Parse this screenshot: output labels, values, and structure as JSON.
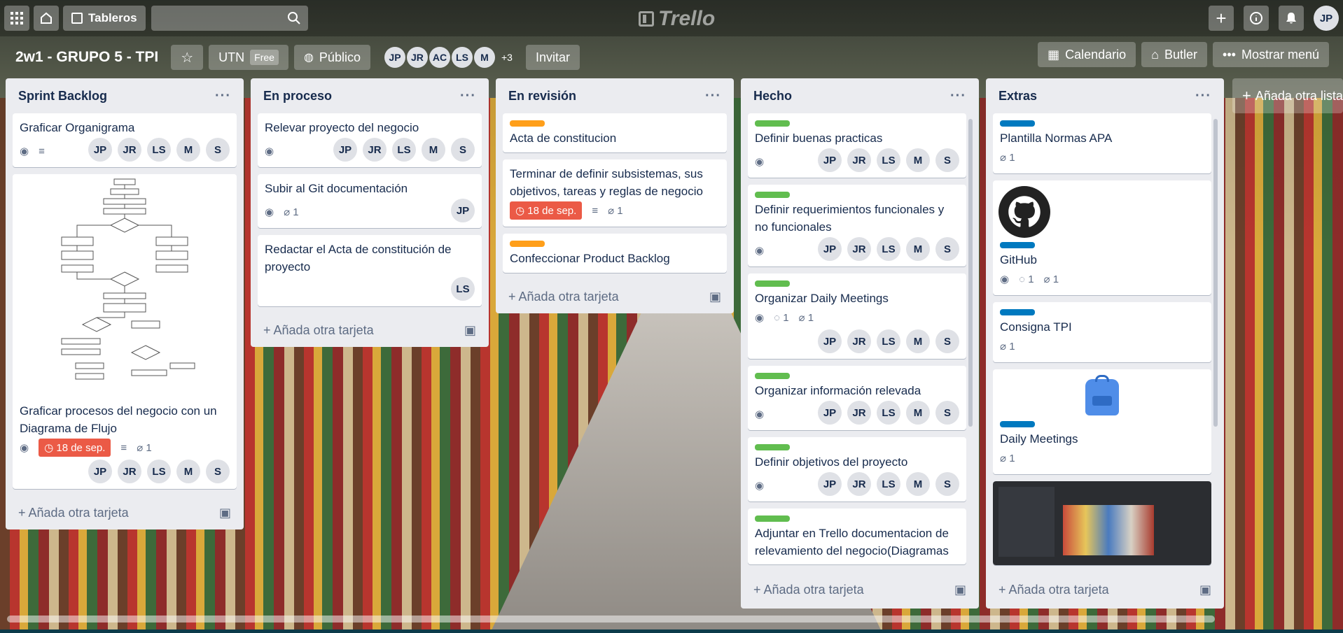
{
  "topbar": {
    "boards_label": "Tableros",
    "logo_text": "Trello",
    "user_initials": "JP"
  },
  "board": {
    "name": "2w1 - GRUPO 5 - TPI",
    "workspace": "UTN",
    "workspace_plan": "Free",
    "visibility": "Público",
    "members": [
      "JP",
      "JR",
      "AC",
      "LS",
      "M"
    ],
    "more_members": "+3",
    "invite": "Invitar",
    "calendar": "Calendario",
    "butler": "Butler",
    "show_menu": "Mostrar menú"
  },
  "add_card": "Añada otra tarjeta",
  "add_list": "Añada otra lista",
  "lists": [
    {
      "title": "Sprint Backlog",
      "cards": [
        {
          "title": "Graficar Organigrama",
          "members": [
            "JP",
            "JR",
            "LS",
            "M",
            "S"
          ]
        },
        {
          "title": "Graficar procesos del negocio con un Diagrama de Flujo",
          "due": "18 de sep.",
          "attachments": "1",
          "members": [
            "JP",
            "JR",
            "LS",
            "M",
            "S"
          ]
        }
      ]
    },
    {
      "title": "En proceso",
      "cards": [
        {
          "title": "Relevar proyecto del negocio",
          "members": [
            "JP",
            "JR",
            "LS",
            "M",
            "S"
          ]
        },
        {
          "title": "Subir al Git documentación",
          "attachments": "1",
          "members": [
            "JP"
          ]
        },
        {
          "title": "Redactar el Acta de constitución de proyecto",
          "members": [
            "LS"
          ]
        }
      ]
    },
    {
      "title": "En revisión",
      "cards": [
        {
          "title": "Acta de constitucion"
        },
        {
          "title": "Terminar de definir subsistemas, sus objetivos, tareas y reglas de negocio",
          "due": "18 de sep.",
          "attachments": "1"
        },
        {
          "title": "Confeccionar Product Backlog"
        }
      ]
    },
    {
      "title": "Hecho",
      "cards": [
        {
          "title": "Definir buenas practicas",
          "members": [
            "JP",
            "JR",
            "LS",
            "M",
            "S"
          ]
        },
        {
          "title": "Definir requerimientos funcionales y no funcionales",
          "members": [
            "JP",
            "JR",
            "LS",
            "M",
            "S"
          ]
        },
        {
          "title": "Organizar Daily Meetings",
          "comments": "1",
          "attachments": "1",
          "members": [
            "JP",
            "JR",
            "LS",
            "M",
            "S"
          ]
        },
        {
          "title": "Organizar información relevada",
          "members": [
            "JP",
            "JR",
            "LS",
            "M",
            "S"
          ]
        },
        {
          "title": "Definir objetivos del proyecto",
          "members": [
            "JP",
            "JR",
            "LS",
            "M",
            "S"
          ]
        },
        {
          "title": "Adjuntar en Trello documentacion de relevamiento del negocio(Diagramas"
        }
      ]
    },
    {
      "title": "Extras",
      "cards": [
        {
          "title": "Plantilla Normas APA",
          "attachments": "1"
        },
        {
          "title": "GitHub",
          "comments": "1",
          "attachments": "1"
        },
        {
          "title": "Consigna TPI",
          "attachments": "1"
        },
        {
          "title": "Daily Meetings",
          "attachments": "1"
        }
      ]
    }
  ],
  "colors": {
    "label_green": "#61bd4f",
    "label_orange": "#ff9f1a",
    "label_blue": "#0079bf",
    "due_overdue": "#eb5a46"
  }
}
